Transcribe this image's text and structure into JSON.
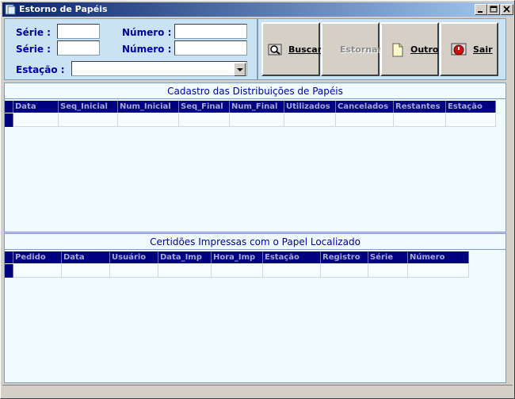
{
  "window": {
    "title": "Estorno de Papéis"
  },
  "form": {
    "serie1_label": "Série :",
    "serie2_label": "Série :",
    "numero1_label": "Número :",
    "numero2_label": "Número :",
    "estacao_label": "Estação :",
    "serie1_value": "",
    "serie2_value": "",
    "numero1_value": "",
    "numero2_value": "",
    "estacao_value": ""
  },
  "buttons": {
    "buscar": "Buscar",
    "estornar": "Estornar",
    "outro": "Outro",
    "sair": "Sair"
  },
  "grid1": {
    "title": "Cadastro das Distribuições de Papéis",
    "columns": [
      "Data",
      "Seq_Inicial",
      "Num_Inicial",
      "Seq_Final",
      "Num_Final",
      "Utilizados",
      "Cancelados",
      "Restantes",
      "Estação"
    ]
  },
  "grid2": {
    "title": "Certidões Impressas com o Papel Localizado",
    "columns": [
      "Pedido",
      "Data",
      "Usuário",
      "Data_Imp",
      "Hora_Imp",
      "Estação",
      "Registro",
      "Série",
      "Número"
    ]
  },
  "colors": {
    "title_bar_start": "#0a246a",
    "header_bg": "#000080",
    "panel_bg": "#c9e3f4",
    "label_color": "#0000a0"
  }
}
